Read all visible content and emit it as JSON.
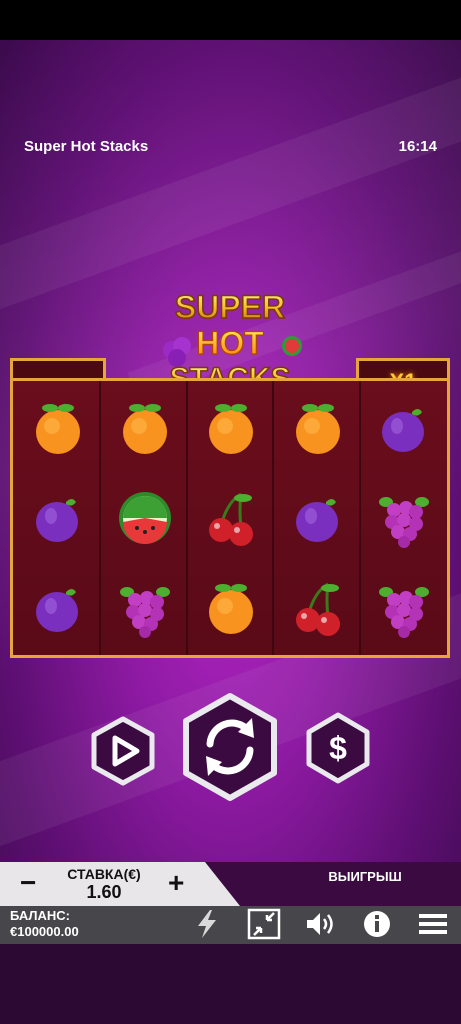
{
  "game": {
    "title": "Super Hot Stacks",
    "clock": "16:14",
    "logo": {
      "line1": "SUPER",
      "line2": "HOT",
      "line3": "STACKS"
    },
    "left_box_value": "",
    "multiplier": "X1"
  },
  "reels": [
    [
      "orange",
      "plum",
      "plum"
    ],
    [
      "orange",
      "watermelon",
      "grapes"
    ],
    [
      "orange",
      "cherry",
      "orange"
    ],
    [
      "orange",
      "plum",
      "cherry"
    ],
    [
      "plum",
      "grapes",
      "grapes"
    ]
  ],
  "controls": {
    "autoplay_icon": "play-icon",
    "spin_icon": "spin-arrows-icon",
    "bet_icon": "dollar-icon"
  },
  "bet": {
    "minus": "−",
    "plus": "+",
    "label": "СТАВКА(€)",
    "value": "1.60",
    "win_label": "ВЫИГРЫШ"
  },
  "balance": {
    "label": "БАЛАНС:",
    "value": "€100000.00"
  },
  "toolbar": {
    "icons": [
      "lightning-icon",
      "fullscreen-icon",
      "sound-icon",
      "info-icon",
      "menu-icon"
    ]
  },
  "colors": {
    "frame_gold": "#e8a63a",
    "reel_bg": "#6a0d1c",
    "bg_purple": "#8e1aa3",
    "bet_panel": "#e9e6e9",
    "toolbar": "#47474b"
  }
}
